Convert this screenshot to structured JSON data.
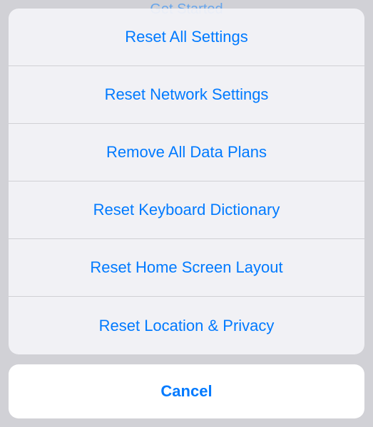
{
  "backdrop": {
    "partial_text": "Get Started"
  },
  "actions": {
    "item0": "Reset All Settings",
    "item1": "Reset Network Settings",
    "item2": "Remove All Data Plans",
    "item3": "Reset Keyboard Dictionary",
    "item4": "Reset Home Screen Layout",
    "item5": "Reset Location & Privacy"
  },
  "cancel_label": "Cancel"
}
